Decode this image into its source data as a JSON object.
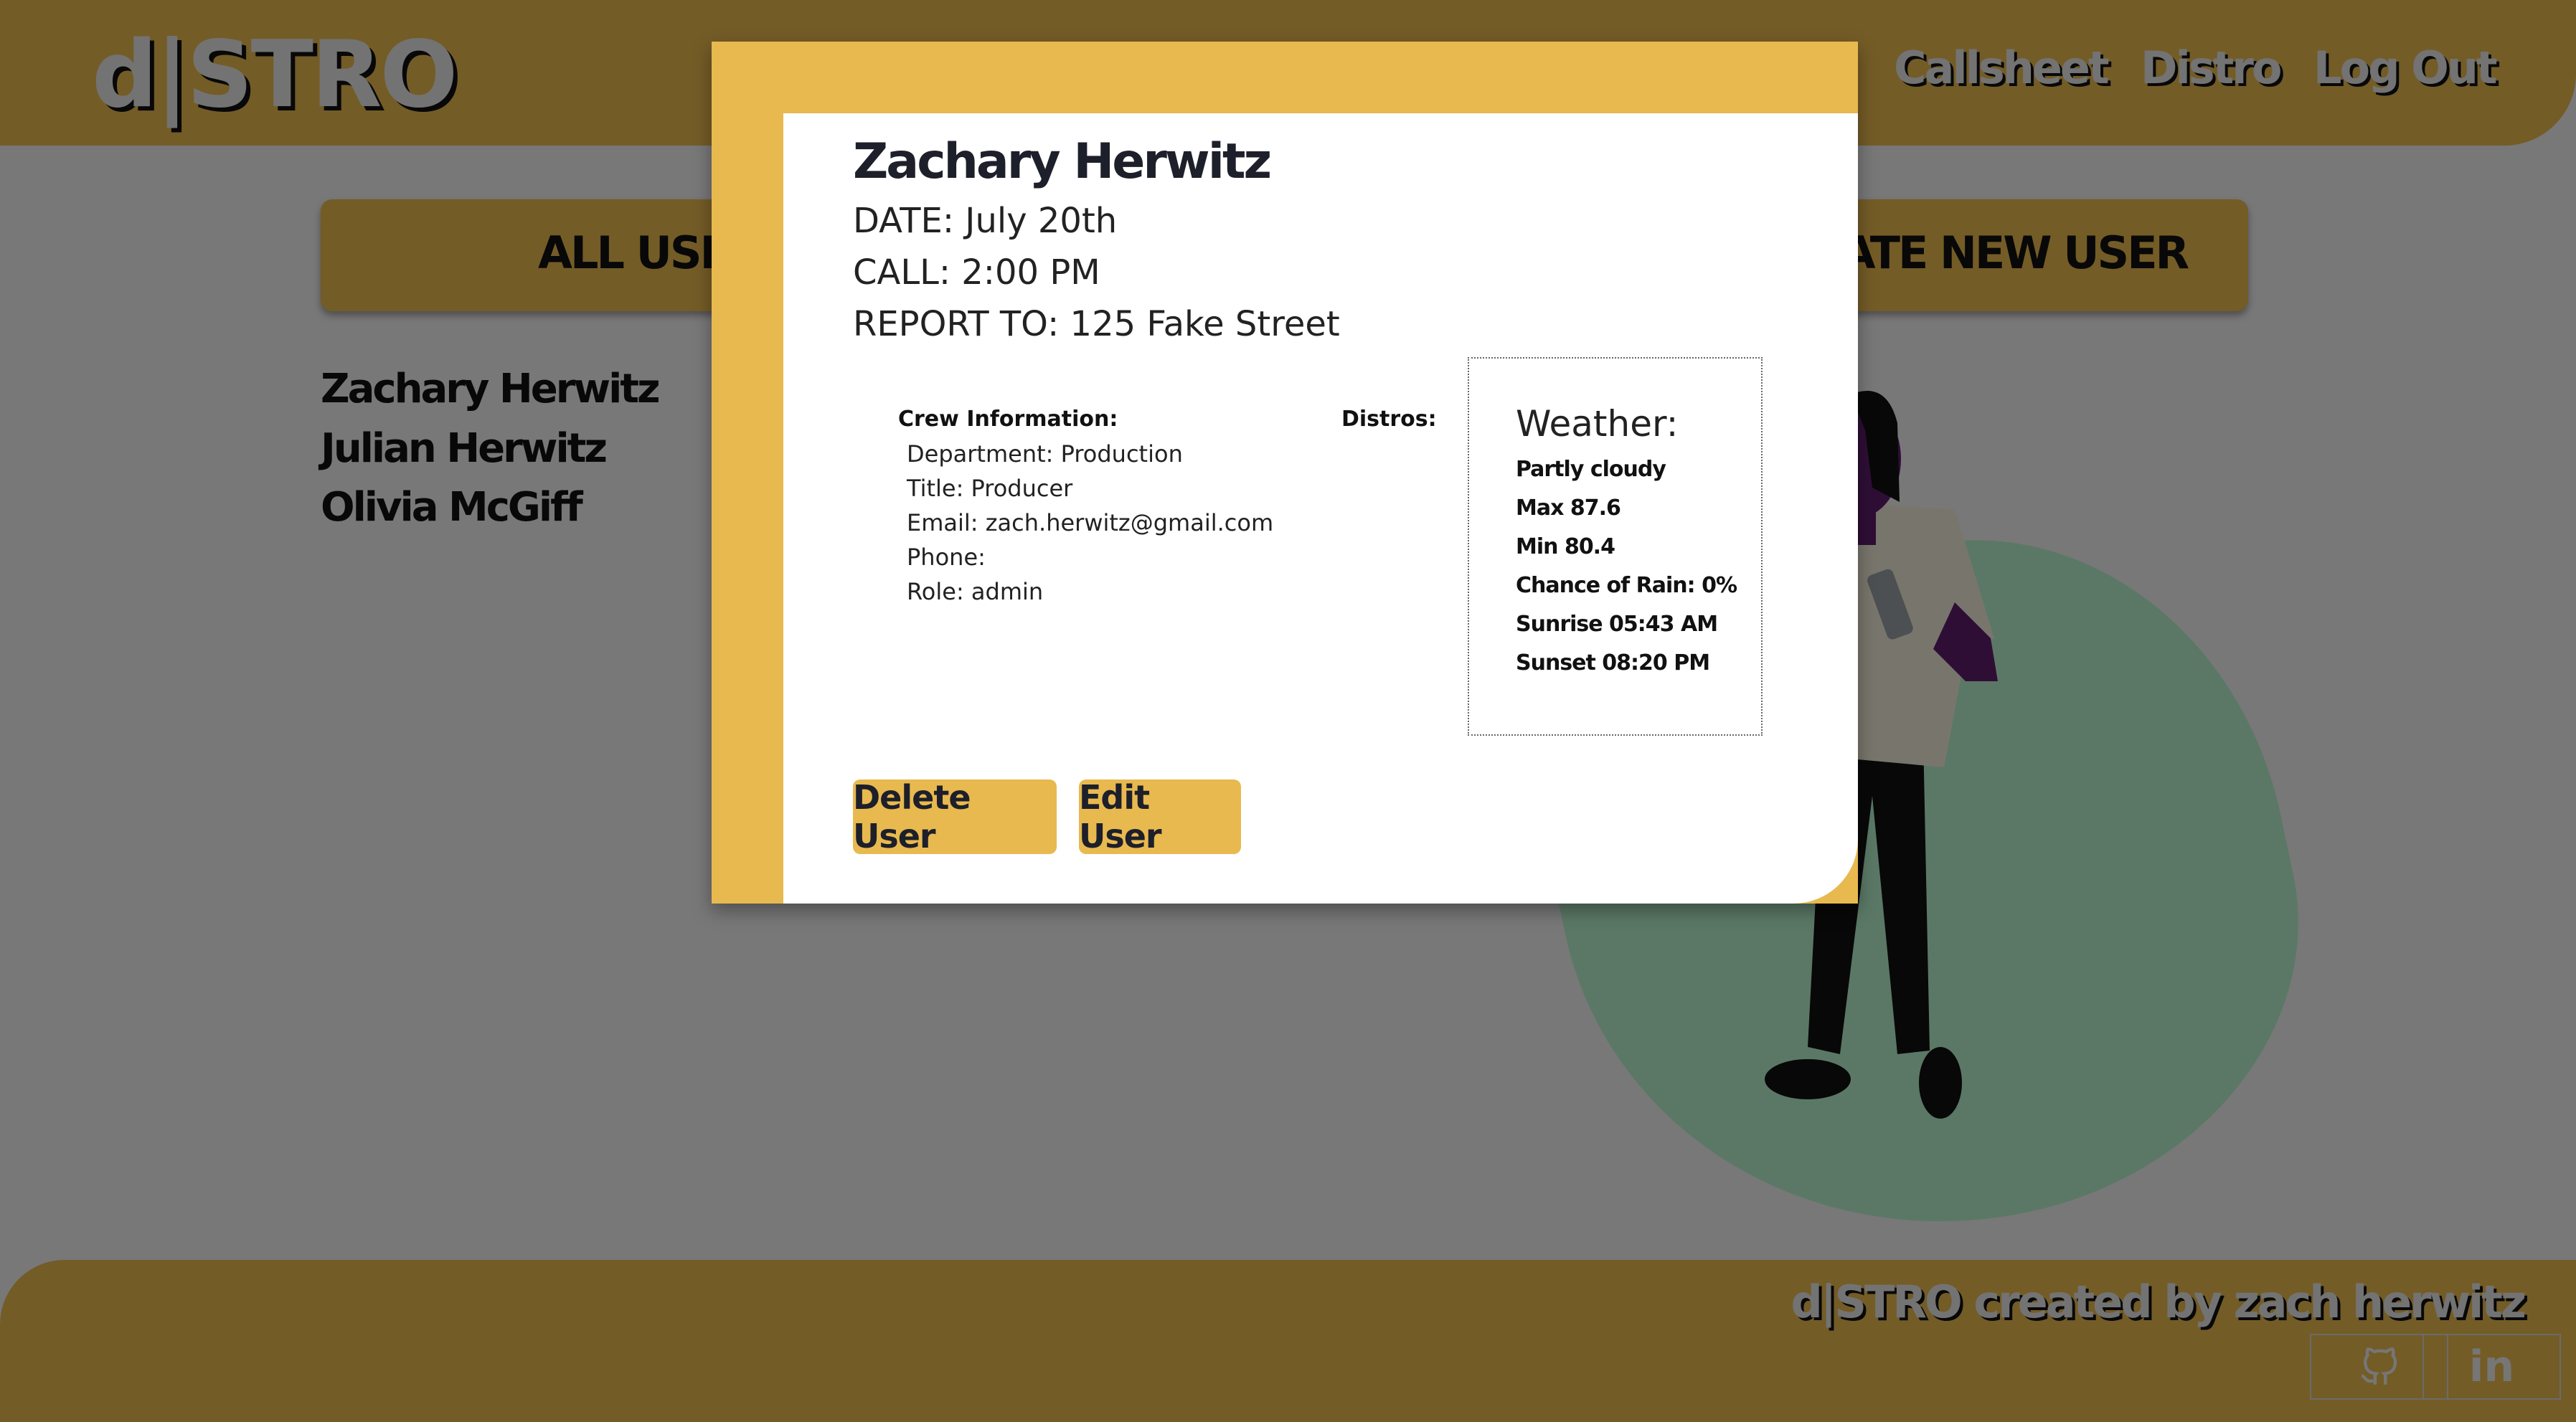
{
  "header": {
    "logo": "d|STRO",
    "nav": [
      "Callsheet",
      "Distro",
      "Log Out"
    ]
  },
  "tabs": {
    "all_users": "ALL USERS",
    "create_new_user": "CREATE NEW USER"
  },
  "users": [
    "Zachary Herwitz",
    "Julian Herwitz",
    "Olivia McGiff"
  ],
  "modal": {
    "name": "Zachary Herwitz",
    "date": "DATE: July 20th",
    "call": "CALL: 2:00 PM",
    "report_to": "REPORT TO: 125 Fake Street",
    "crew_heading": "Crew Information:",
    "crew": [
      "Department: Production",
      "Title: Producer",
      "Email: zach.herwitz@gmail.com",
      "Phone:",
      "Role: admin"
    ],
    "distros_heading": "Distros:",
    "weather": {
      "title": "Weather:",
      "lines": [
        "Partly cloudy",
        "Max 87.6",
        "Min 80.4",
        "Chance of Rain: 0%",
        "Sunrise 05:43 AM",
        "Sunset 08:20 PM"
      ]
    },
    "delete_label": "Delete User",
    "edit_label": "Edit User"
  },
  "footer": {
    "credit": "d|STRO created by zach herwitz",
    "github_icon": "github-icon",
    "linkedin_label": "in"
  },
  "colors": {
    "accent": "#e8b94f",
    "overlay": "rgba(0,0,0,0.5)",
    "blob": "#b7f0cc"
  }
}
